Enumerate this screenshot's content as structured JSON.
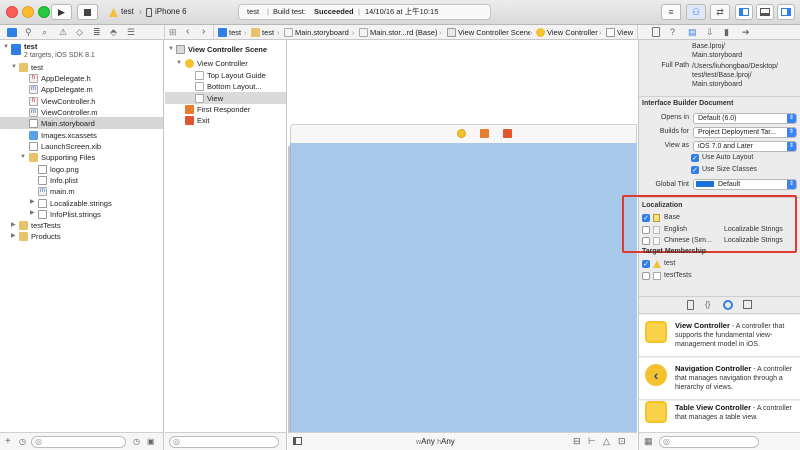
{
  "toolbar": {
    "scheme": "test",
    "device": "iPhone 6",
    "status_project": "test",
    "status_build": "Build test:",
    "status_result": "Succeeded",
    "status_time": "14/10/16 at 上午10:15"
  },
  "jumpbar": {
    "crumbs": [
      "test",
      "test",
      "Main.storyboard",
      "Main.stor...rd (Base)",
      "View Controller Scene",
      "View Controller",
      "View"
    ]
  },
  "navigator": {
    "project": "test",
    "project_sub": "2 targets, iOS SDK 8.1",
    "group": "test",
    "files": [
      "AppDelegate.h",
      "AppDelegate.m",
      "ViewController.h",
      "ViewController.m",
      "Main.storyboard",
      "Images.xcassets",
      "LaunchScreen.xib"
    ],
    "supporting": "Supporting Files",
    "supporting_files": [
      "logo.png",
      "Info.plist",
      "main.m",
      "Localizable.strings",
      "InfoPlist.strings"
    ],
    "groups": [
      "testTests",
      "Products"
    ]
  },
  "outline": {
    "scene": "View Controller Scene",
    "controller": "View Controller",
    "children": [
      "Top Layout Guide",
      "Bottom Layout...",
      "View"
    ],
    "first_responder": "First Responder",
    "exit": "Exit"
  },
  "canvas": {
    "size_w": "w",
    "size_any1": "Any",
    "size_h": "h",
    "size_any2": "Any"
  },
  "inspector": {
    "path_top": "Base.lproj/\nMain.storyboard",
    "full_path_label": "Full Path",
    "full_path": "/Users/liuhongbao/Desktop/\ntest/test/Base.lproj/\nMain.storyboard",
    "ib_title": "Interface Builder Document",
    "opens_in_label": "Opens in",
    "opens_in": "Default (6.0)",
    "builds_for_label": "Builds for",
    "builds_for": "Project Deployment Tar...",
    "view_as_label": "View as",
    "view_as": "iOS 7.0 and Later",
    "use_auto_layout": "Use Auto Layout",
    "use_size_classes": "Use Size Classes",
    "global_tint_label": "Global Tint",
    "global_tint": "Default",
    "localization_title": "Localization",
    "localizations": [
      {
        "name": "Base",
        "type": ""
      },
      {
        "name": "English",
        "type": "Localizable Strings"
      },
      {
        "name": "Chinese (Sim...",
        "type": "Localizable Strings"
      }
    ],
    "target_title": "Target Membership",
    "targets": [
      "test",
      "testTests"
    ]
  },
  "library": [
    {
      "title": "View Controller",
      "desc": " - A controller that supports the fundamental view-management model in iOS."
    },
    {
      "title": "Navigation Controller",
      "desc": " - A controller that manages navigation through a hierarchy of views."
    },
    {
      "title": "Table View Controller",
      "desc": " - A controller that manages a table view."
    }
  ],
  "colors": {
    "accent": "#2f7fe6",
    "canvas_view": "#a8c8ea",
    "highlight_box": "#e03a2f"
  }
}
